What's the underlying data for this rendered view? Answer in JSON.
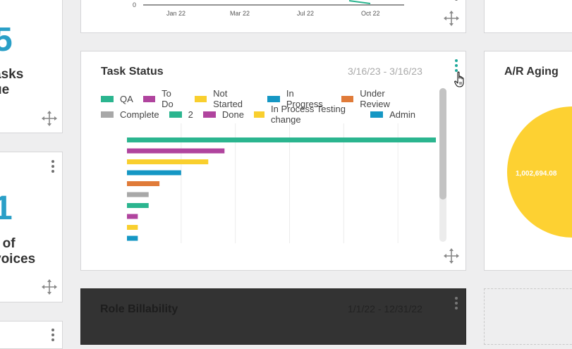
{
  "top_chart": {
    "y_tick": "0",
    "x_ticks": [
      "Jan 22",
      "Mar 22",
      "Jul 22",
      "Oct 22"
    ]
  },
  "left_column": {
    "card1": {
      "number_fragment": "5",
      "label_line1": "asks",
      "label_line2": "ue"
    },
    "card2": {
      "number_fragment": "1",
      "label_line1": "r of",
      "label_line2": "voices"
    }
  },
  "task_status": {
    "title": "Task Status",
    "date_range": "3/16/23 - 3/16/23",
    "legend": [
      {
        "label": "QA",
        "color": "#2bb58f"
      },
      {
        "label": "To Do",
        "color": "#b0449e"
      },
      {
        "label": "Not Started",
        "color": "#f9cf2e"
      },
      {
        "label": "In Progress",
        "color": "#1597c4"
      },
      {
        "label": "Under Review",
        "color": "#e07b39"
      },
      {
        "label": "Complete",
        "color": "#a8a8a8"
      },
      {
        "label": "2",
        "color": "#2bb58f"
      },
      {
        "label": "Done",
        "color": "#b0449e"
      },
      {
        "label": "In Process Testing change",
        "color": "#f9cf2e"
      },
      {
        "label": "Admin",
        "color": "#1597c4"
      }
    ]
  },
  "chart_data": {
    "type": "bar",
    "orientation": "horizontal",
    "categories": [
      "QA",
      "To Do",
      "Not Started",
      "In Progress",
      "Under Review",
      "Complete",
      "2",
      "Done",
      "In Process Testing change",
      "Admin"
    ],
    "values": [
      57,
      18,
      15,
      10,
      6,
      4,
      4,
      2,
      2,
      2
    ],
    "colors": [
      "#2bb58f",
      "#b0449e",
      "#f9cf2e",
      "#1597c4",
      "#e07b39",
      "#a8a8a8",
      "#2bb58f",
      "#b0449e",
      "#f9cf2e",
      "#1597c4"
    ],
    "xlim": [
      0,
      57
    ],
    "grid": true,
    "legend_position": "top"
  },
  "ar_aging": {
    "title": "A/R Aging",
    "slice_label": "1,002,694.08",
    "slice_color": "#fdd132"
  },
  "role_billability": {
    "title": "Role Billability",
    "date_range": "1/1/22 - 12/31/22"
  }
}
